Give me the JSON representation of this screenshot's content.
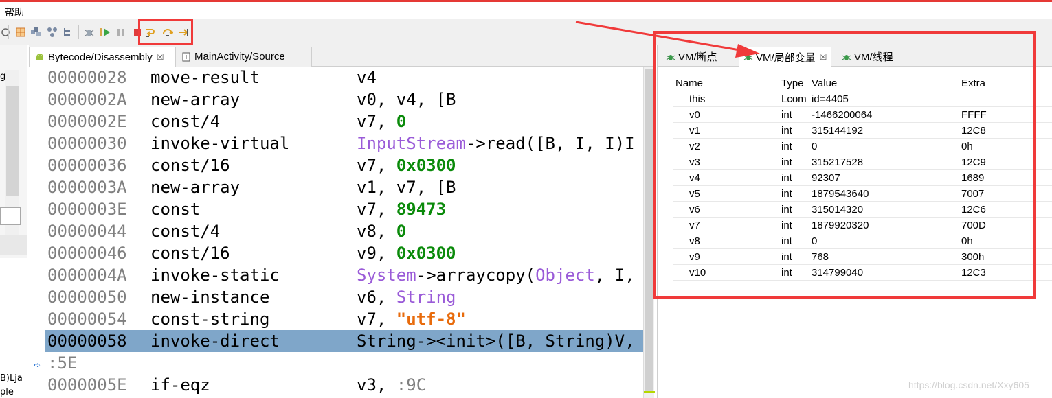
{
  "menubar": {
    "help_label": "帮助"
  },
  "colors": {
    "highlight_red": "#f03a3a",
    "selected_line": "#7fa6c9",
    "number_green": "#0a8a0a",
    "type_purple": "#9a5bd8",
    "string_orange": "#e86b0c"
  },
  "toolbar": {
    "icons": [
      "layout-grid-icon",
      "table-icon",
      "nodes-icon",
      "tree-icon",
      "debug-bug-icon",
      "run-icon",
      "pause-icon",
      "stop-icon",
      "step-into-icon",
      "step-over-icon",
      "step-return-icon"
    ]
  },
  "left_panel": {
    "fragment_top": "g",
    "fragment_bottom_1": "B)Lja",
    "fragment_bottom_2": "ple"
  },
  "editor": {
    "tabs": [
      {
        "label": "Bytecode/Disassembly",
        "close": "☒"
      },
      {
        "label": "MainActivity/Source"
      }
    ],
    "lines": [
      {
        "addr": "00000028",
        "op": "move-result",
        "args": [
          {
            "t": "v4",
            "k": "plain"
          }
        ]
      },
      {
        "addr": "0000002A",
        "op": "new-array",
        "args": [
          {
            "t": "v0, v4, [B",
            "k": "plain"
          }
        ]
      },
      {
        "addr": "0000002E",
        "op": "const/4",
        "args": [
          {
            "t": "v7, ",
            "k": "plain"
          },
          {
            "t": "0",
            "k": "num"
          }
        ]
      },
      {
        "addr": "00000030",
        "op": "invoke-virtual",
        "args": [
          {
            "t": "InputStream",
            "k": "type"
          },
          {
            "t": "->read([B, I, I)I",
            "k": "plain"
          }
        ]
      },
      {
        "addr": "00000036",
        "op": "const/16",
        "args": [
          {
            "t": "v7, ",
            "k": "plain"
          },
          {
            "t": "0x0300",
            "k": "num"
          }
        ]
      },
      {
        "addr": "0000003A",
        "op": "new-array",
        "args": [
          {
            "t": "v1, v7, [B",
            "k": "plain"
          }
        ]
      },
      {
        "addr": "0000003E",
        "op": "const",
        "args": [
          {
            "t": "v7, ",
            "k": "plain"
          },
          {
            "t": "89473",
            "k": "num"
          }
        ]
      },
      {
        "addr": "00000044",
        "op": "const/4",
        "args": [
          {
            "t": "v8, ",
            "k": "plain"
          },
          {
            "t": "0",
            "k": "num"
          }
        ]
      },
      {
        "addr": "00000046",
        "op": "const/16",
        "args": [
          {
            "t": "v9, ",
            "k": "plain"
          },
          {
            "t": "0x0300",
            "k": "num"
          }
        ]
      },
      {
        "addr": "0000004A",
        "op": "invoke-static",
        "args": [
          {
            "t": "System",
            "k": "type"
          },
          {
            "t": "->arraycopy(",
            "k": "plain"
          },
          {
            "t": "Object",
            "k": "type"
          },
          {
            "t": ", I,",
            "k": "plain"
          }
        ]
      },
      {
        "addr": "00000050",
        "op": "new-instance",
        "args": [
          {
            "t": "v6, ",
            "k": "plain"
          },
          {
            "t": "String",
            "k": "type"
          }
        ]
      },
      {
        "addr": "00000054",
        "op": "const-string",
        "args": [
          {
            "t": "v7, ",
            "k": "plain"
          },
          {
            "t": "\"utf-8\"",
            "k": "str"
          }
        ]
      },
      {
        "addr": "00000058",
        "op": "invoke-direct",
        "args": [
          {
            "t": "String-><init>([B, String)V,",
            "k": "plain"
          }
        ],
        "highlight": true
      },
      {
        "addr": ":5E",
        "op": "",
        "args": [],
        "label": true
      },
      {
        "addr": "0000005E",
        "op": "if-eqz",
        "args": [
          {
            "t": "v3, ",
            "k": "plain"
          },
          {
            "t": ":9C",
            "k": "label"
          }
        ]
      }
    ]
  },
  "vm_panel": {
    "tabs": [
      {
        "label": "VM/断点"
      },
      {
        "label": "VM/局部变量",
        "close": "☒"
      },
      {
        "label": "VM/线程"
      }
    ],
    "columns": {
      "name": "Name",
      "type": "Type",
      "value": "Value",
      "extra": "Extra"
    },
    "rows": [
      {
        "name": "this",
        "type": "Lcom",
        "value": "id=4405",
        "extra": ""
      },
      {
        "name": "v0",
        "type": "int",
        "value": "-1466200064",
        "extra": "FFFFF"
      },
      {
        "name": "v1",
        "type": "int",
        "value": "315144192",
        "extra": "12C8"
      },
      {
        "name": "v2",
        "type": "int",
        "value": "0",
        "extra": "0h"
      },
      {
        "name": "v3",
        "type": "int",
        "value": "315217528",
        "extra": "12C9"
      },
      {
        "name": "v4",
        "type": "int",
        "value": "92307",
        "extra": "1689"
      },
      {
        "name": "v5",
        "type": "int",
        "value": "1879543640",
        "extra": "7007"
      },
      {
        "name": "v6",
        "type": "int",
        "value": "315014320",
        "extra": "12C6"
      },
      {
        "name": "v7",
        "type": "int",
        "value": "1879920320",
        "extra": "700D"
      },
      {
        "name": "v8",
        "type": "int",
        "value": "0",
        "extra": "0h"
      },
      {
        "name": "v9",
        "type": "int",
        "value": "768",
        "extra": "300h"
      },
      {
        "name": "v10",
        "type": "int",
        "value": "314799040",
        "extra": "12C3"
      }
    ]
  },
  "watermark": "https://blog.csdn.net/Xxy605"
}
